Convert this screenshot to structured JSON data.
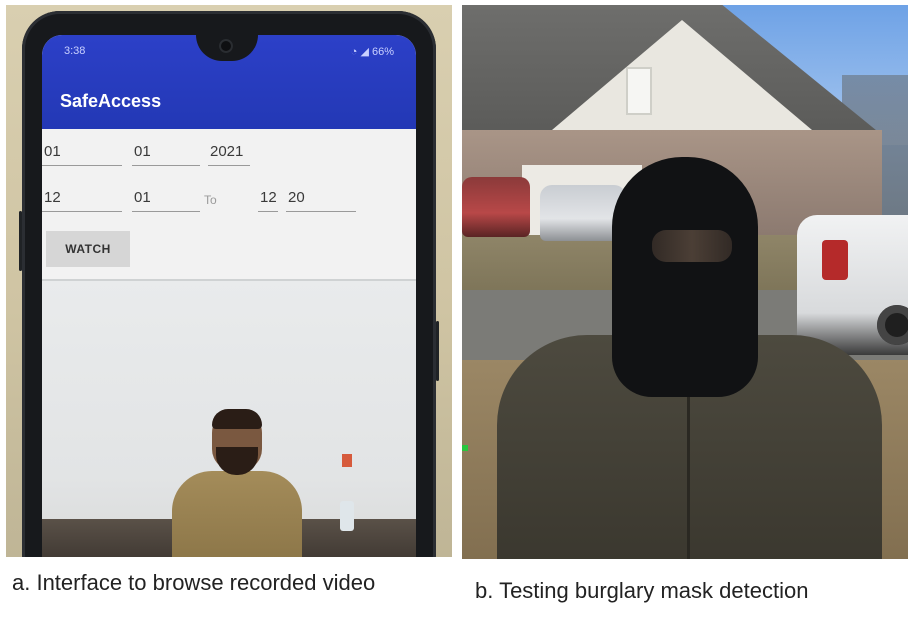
{
  "panel_a": {
    "status_bar": {
      "time": "3:38",
      "battery": "66%"
    },
    "app_title": "SafeAccess",
    "form": {
      "start_day": "01",
      "start_month": "01",
      "start_year": "2021",
      "from_hour": "12",
      "from_minute": "01",
      "to_label": "To",
      "to_hour": "12",
      "to_minute": "20",
      "watch_label": "WATCH"
    },
    "colors": {
      "appbar": "#2338b5",
      "form_bg": "#f2f2f2"
    }
  },
  "captions": {
    "a": "a. Interface to browse recorded video",
    "b": "b. Testing burglary mask detection"
  }
}
